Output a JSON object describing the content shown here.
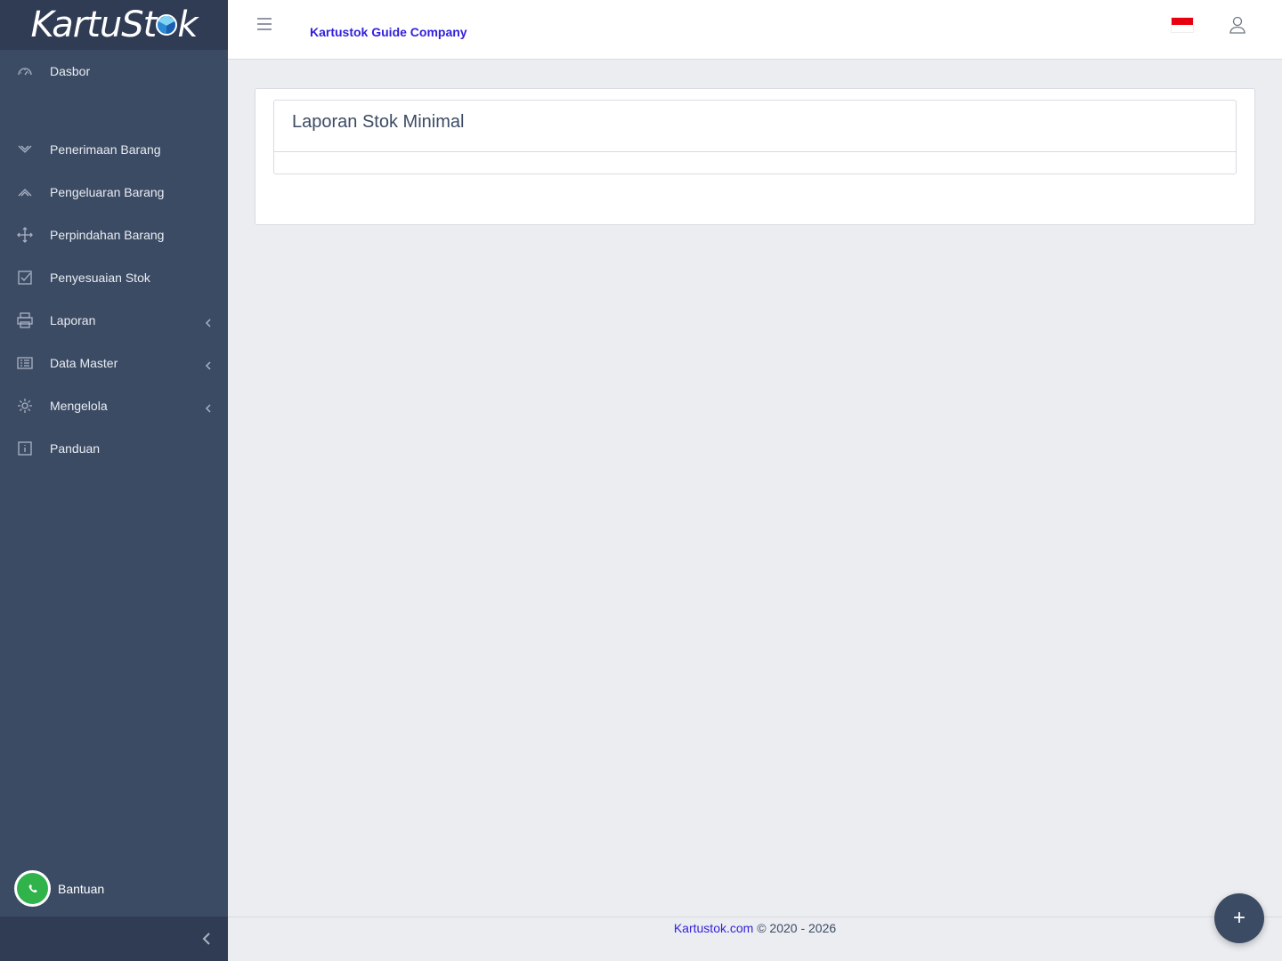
{
  "brand": {
    "name_prefix": "KartuSt",
    "name_suffix": "k"
  },
  "header": {
    "company": "Kartustok Guide Company",
    "language_flag": "indonesia-flag",
    "user_icon": "user-icon"
  },
  "sidebar": {
    "items": [
      {
        "label": "Dasbor",
        "icon": "speedometer-icon"
      },
      {
        "label": "Penerimaan Barang",
        "icon": "chevron-down-icon"
      },
      {
        "label": "Pengeluaran Barang",
        "icon": "chevron-up-icon"
      },
      {
        "label": "Perpindahan Barang",
        "icon": "move-icon"
      },
      {
        "label": "Penyesuaian Stok",
        "icon": "check-square-icon"
      },
      {
        "label": "Laporan",
        "icon": "printer-icon"
      },
      {
        "label": "Data Master",
        "icon": "list-icon"
      },
      {
        "label": "Mengelola",
        "icon": "settings-icon"
      },
      {
        "label": "Panduan",
        "icon": "info-icon"
      }
    ],
    "help_label": "Bantuan"
  },
  "main": {
    "card_title": "Laporan Stok Minimal"
  },
  "footer": {
    "link": "Kartustok.com",
    "copyright": " © 2020 - 2026"
  },
  "fab": {
    "label": "+"
  },
  "colors": {
    "sidebar": "#3c4b64",
    "brand_bar": "#303c54",
    "accent": "#321fdb",
    "whatsapp": "#2fb34a"
  }
}
